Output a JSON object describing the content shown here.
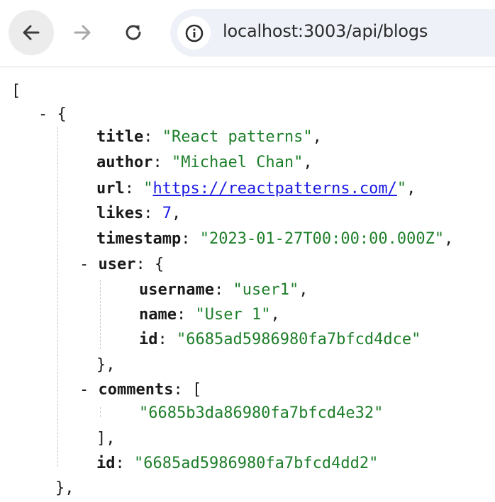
{
  "browser": {
    "url": "localhost:3003/api/blogs"
  },
  "json_view": {
    "open_array": "[",
    "collapse_toggle": "-",
    "open_object": "{",
    "entry": {
      "title_key": "title",
      "title_value": "\"React patterns\"",
      "author_key": "author",
      "author_value": "\"Michael Chan\"",
      "url_key": "url",
      "url_value": "https://reactpatterns.com/",
      "likes_key": "likes",
      "likes_value": "7",
      "timestamp_key": "timestamp",
      "timestamp_value": "\"2023-01-27T00:00:00.000Z\"",
      "user_key": "user",
      "user": {
        "username_key": "username",
        "username_value": "\"user1\"",
        "name_key": "name",
        "name_value": "\"User 1\"",
        "id_key": "id",
        "id_value": "\"6685ad5986980fa7bfcd4dce\""
      },
      "user_close": "},",
      "comments_key": "comments",
      "comments": [
        "\"6685b3da86980fa7bfcd4e32\""
      ],
      "comments_close": "],",
      "id_key": "id",
      "id_value": "\"6685ad5986980fa7bfcd4dd2\""
    },
    "close_object": "},"
  },
  "icons": {
    "back": "arrow-left-icon",
    "forward": "arrow-right-icon",
    "reload": "reload-icon",
    "site_info": "info-icon"
  },
  "colors": {
    "string": "#1e7f2a",
    "number": "#1a1ae6",
    "link": "#1a1ae6",
    "key": "#1a1a1a"
  }
}
